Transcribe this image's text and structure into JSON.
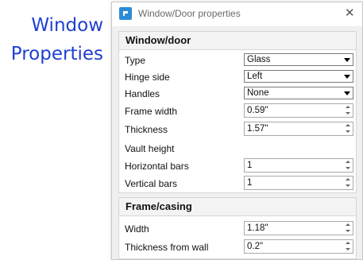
{
  "side_title": {
    "line1": "Window",
    "line2": "Properties"
  },
  "dialog": {
    "title": "Window/Door properties",
    "app_icon": "app-logo-icon",
    "close_icon": "close-icon"
  },
  "sections": {
    "window_door": {
      "header": "Window/door",
      "type": {
        "label": "Type",
        "value": "Glass"
      },
      "hinge_side": {
        "label": "Hinge side",
        "value": "Left"
      },
      "handles": {
        "label": "Handles",
        "value": "None"
      },
      "frame_width": {
        "label": "Frame width",
        "value": "0.59\""
      },
      "thickness": {
        "label": "Thickness",
        "value": "1.57\""
      },
      "vault_height": {
        "label": "Vault height"
      },
      "horizontal_bars": {
        "label": "Horizontal bars",
        "value": "1"
      },
      "vertical_bars": {
        "label": "Vertical bars",
        "value": "1"
      }
    },
    "frame_casing": {
      "header": "Frame/casing",
      "width": {
        "label": "Width",
        "value": "1.18\""
      },
      "thickness_from_wall": {
        "label": "Thickness from wall",
        "value": "0.2\""
      }
    }
  },
  "colors": {
    "accent_title": "#1f3fd1",
    "app_icon": "#2d8bd6"
  }
}
